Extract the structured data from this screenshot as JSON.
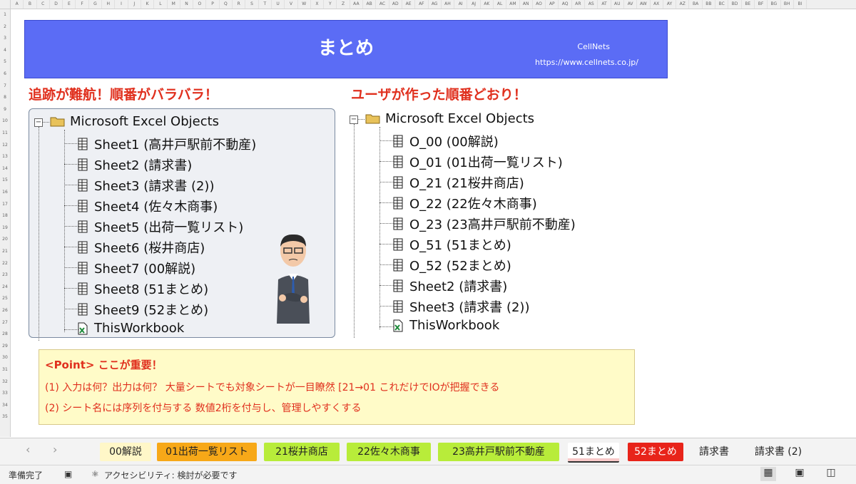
{
  "columns": [
    "A",
    "B",
    "C",
    "D",
    "E",
    "F",
    "G",
    "H",
    "I",
    "J",
    "K",
    "L",
    "M",
    "N",
    "O",
    "P",
    "Q",
    "R",
    "S",
    "T",
    "U",
    "V",
    "W",
    "X",
    "Y",
    "Z",
    "AA",
    "AB",
    "AC",
    "AD",
    "AE",
    "AF",
    "AG",
    "AH",
    "AI",
    "AJ",
    "AK",
    "AL",
    "AM",
    "AN",
    "AO",
    "AP",
    "AQ",
    "AR",
    "AS",
    "AT",
    "AU",
    "AV",
    "AW",
    "AX",
    "AY",
    "AZ",
    "BA",
    "BB",
    "BC",
    "BD",
    "BE",
    "BF",
    "BG",
    "BH",
    "BI"
  ],
  "rows": [
    "1",
    "2",
    "3",
    "4",
    "5",
    "6",
    "7",
    "8",
    "9",
    "10",
    "11",
    "12",
    "13",
    "14",
    "15",
    "16",
    "17",
    "18",
    "19",
    "20",
    "21",
    "22",
    "23",
    "24",
    "25",
    "26",
    "27",
    "28",
    "29",
    "30",
    "31",
    "32",
    "33",
    "34",
    "35"
  ],
  "banner": {
    "title": "まとめ",
    "logo": "CellNets",
    "url": "https://www.cellnets.co.jp/"
  },
  "left": {
    "heading": "追跡が難航！順番がバラバラ！",
    "root": "Microsoft Excel Objects",
    "items": [
      "Sheet1 (高井戸駅前不動産)",
      "Sheet2 (請求書)",
      "Sheet3 (請求書 (2))",
      "Sheet4 (佐々木商事)",
      "Sheet5 (出荷一覧リスト)",
      "Sheet6 (桜井商店)",
      "Sheet7 (00解説)",
      "Sheet8 (51まとめ)",
      "Sheet9 (52まとめ)"
    ],
    "workbook": "ThisWorkbook"
  },
  "right": {
    "heading": "ユーザが作った順番どおり！",
    "root": "Microsoft Excel Objects",
    "items": [
      "O_00 (00解説)",
      "O_01 (01出荷一覧リスト)",
      "O_21 (21桜井商店)",
      "O_22 (22佐々木商事)",
      "O_23 (23高井戸駅前不動産)",
      "O_51 (51まとめ)",
      "O_52 (52まとめ)",
      "Sheet2 (請求書)",
      "Sheet3 (請求書 (2))"
    ],
    "workbook": "ThisWorkbook"
  },
  "point": {
    "title": "<Point> ここが重要！",
    "line1": "(1) 入力は何？出力は何？ 大量シートでも対象シートが一目瞭然 [21→01 これだけでIOが把握できる",
    "line2": "(2) シート名には序列を付与する 数値2桁を付与し、管理しやすくする"
  },
  "tabs": [
    {
      "label": "00解説",
      "color": "#fff7c8"
    },
    {
      "label": "01出荷一覧リスト",
      "color": "#f7a818"
    },
    {
      "label": "21桜井商店",
      "color": "#b8ec3a"
    },
    {
      "label": "22佐々木商事",
      "color": "#b8ec3a"
    },
    {
      "label": "23高井戸駅前不動産",
      "color": "#b8ec3a"
    },
    {
      "label": "51まとめ",
      "color": "#f8c8c8"
    },
    {
      "label": "52まとめ",
      "color": "#e8241a"
    },
    {
      "label": "請求書",
      "color": "#f3f3f3"
    },
    {
      "label": "請求書 (2)",
      "color": "#f3f3f3"
    }
  ],
  "status": {
    "ready": "準備完了",
    "accessibility": "アクセシビリティ: 検討が必要です"
  },
  "colors": {
    "banner": "#5b6cf5",
    "heading": "#e0301e",
    "point_bg": "#fffbc8"
  }
}
